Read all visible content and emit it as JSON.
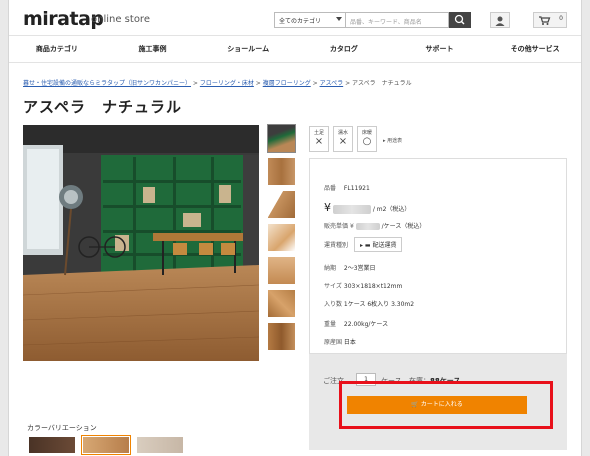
{
  "header": {
    "logo": "miratap",
    "logo_sub": "online store",
    "category_select": "全てのカテゴリ",
    "search_placeholder": "品番、キーワード、商品名",
    "cart_count": "0"
  },
  "nav": [
    "商品カテゴリ",
    "施工事例",
    "ショールーム",
    "カタログ",
    "サポート",
    "その他サービス"
  ],
  "breadcrumb": {
    "links": [
      "暮せ・住宅設備の通販ならミラタップ（旧サンワカンパニー）",
      "フローリング・床材",
      "複層フローリング",
      "アスペラ"
    ],
    "current": "アスペラ　ナチュラル"
  },
  "title": "アスペラ　ナチュラル",
  "flags": [
    {
      "label": "土足",
      "mark": "×"
    },
    {
      "label": "濡水",
      "mark": "×"
    },
    {
      "label": "床暖",
      "mark": "○"
    }
  ],
  "flag_link": "用途表",
  "info": {
    "code_label": "品番",
    "code": "FL11921",
    "price_prefix": "¥",
    "price_unit": "/ m2（税込）",
    "unit_price_label": "販売単価",
    "unit_price_prefix": "¥",
    "unit_price_unit": "/ケース（税込）",
    "shipping_label": "運賃種別",
    "shipping_button": "配送運賃",
    "lead_label": "納期",
    "lead": "2〜3営業日",
    "size_label": "サイズ",
    "size": "303×1818×t12mm",
    "qty_label": "入り数",
    "qty": "1ケース 6枚入り 3.30m2",
    "weight_label": "重量",
    "weight": "22.00kg/ケース",
    "origin_label": "原産国",
    "origin": "日本"
  },
  "order": {
    "qty_label": "ご注文",
    "qty_value": "1",
    "unit": "ケース",
    "stock_label": "在庫：",
    "stock_value": "88ケース",
    "cart_button": "カートに入れる"
  },
  "variation_label": "カラーバリエーション",
  "colors": {
    "accent": "#f08300",
    "highlight": "#e8101a",
    "link": "#2a5db0"
  }
}
